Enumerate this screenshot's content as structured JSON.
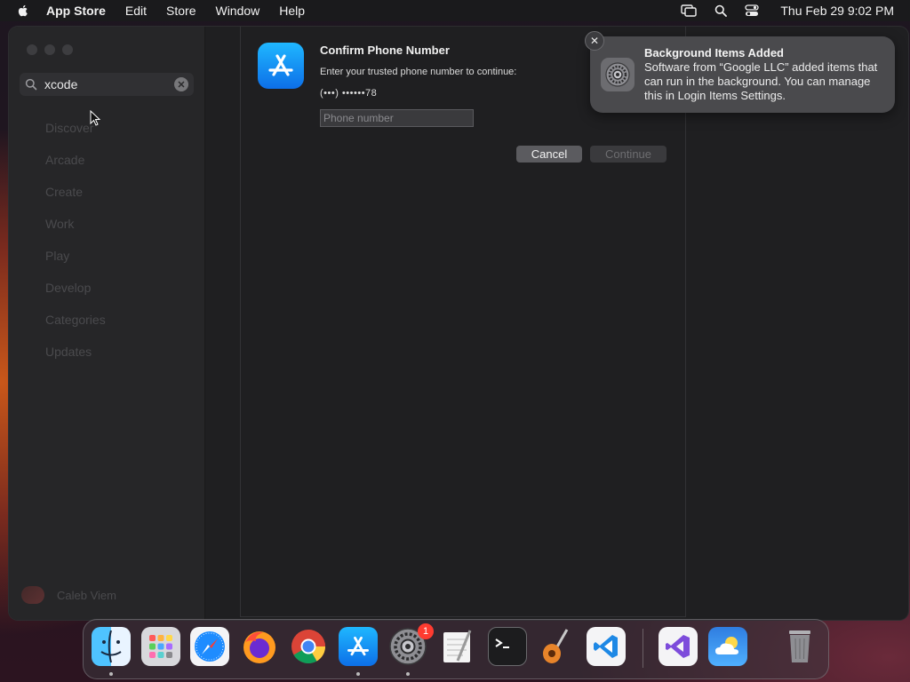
{
  "menubar": {
    "app_name": "App Store",
    "items": [
      "Edit",
      "Store",
      "Window",
      "Help"
    ],
    "clock": "Thu Feb 29  9:02 PM"
  },
  "sidebar": {
    "search_value": "xcode",
    "nav": [
      "Discover",
      "Arcade",
      "Create",
      "Work",
      "Play",
      "Develop",
      "Categories",
      "Updates"
    ],
    "user_name": "Caleb Viem"
  },
  "dialog": {
    "title": "Confirm Phone Number",
    "prompt": "Enter your trusted phone number to continue:",
    "masked_number": "(•••) ••••••78",
    "phone_placeholder": "Phone number",
    "cancel_label": "Cancel",
    "continue_label": "Continue"
  },
  "notification": {
    "title": "Background Items Added",
    "body": "Software from “Google LLC” added items that can run in the background. You can manage this in Login Items Settings.",
    "close_glyph": "✕"
  },
  "dock": {
    "apps": [
      "finder-icon",
      "launchpad-icon",
      "safari-icon",
      "firefox-icon",
      "chrome-icon",
      "app-store-icon",
      "system-settings-icon",
      "textedit-icon",
      "terminal-icon",
      "garageband-icon",
      "vscode-icon",
      "visual-studio-icon",
      "weather-icon",
      "trash-icon"
    ],
    "settings_badge": "1"
  },
  "colors": {
    "accent": "#0d6fe8",
    "badge": "#ff3b30"
  }
}
